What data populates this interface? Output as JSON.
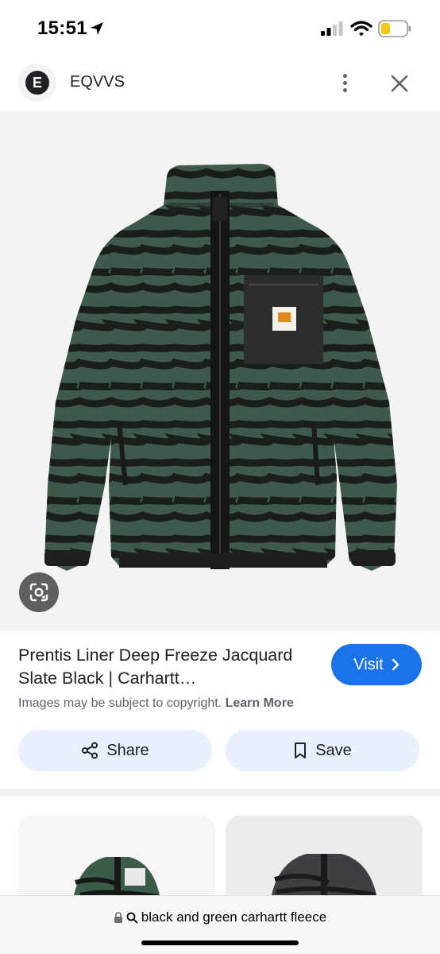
{
  "status_bar": {
    "time": "15:51",
    "icons": [
      "location-arrow-icon",
      "cellular-signal-icon",
      "wifi-icon",
      "battery-low-icon"
    ],
    "battery_color": "#f5c518"
  },
  "source": {
    "avatar_letter": "E",
    "name": "EQVVS",
    "icons": [
      "more-vert-icon",
      "close-icon"
    ]
  },
  "image": {
    "subject": "green and black striped sherpa fleece jacket",
    "lens_icon": "google-lens-icon"
  },
  "result": {
    "title": "Prentis Liner Deep Freeze Jacquard Slate Black | Carhartt…",
    "visit_label": "Visit",
    "copyright_text": "Images may be subject to copyright.",
    "learn_more_label": "Learn More"
  },
  "actions": {
    "share_label": "Share",
    "save_label": "Save"
  },
  "url_bar": {
    "query": "black and green carhartt fleece"
  },
  "colors": {
    "accent": "#1a73e8",
    "action_bg": "#e8f0fe",
    "fleece_green": "#3e5a4b",
    "stripe_black": "#1b1f1c"
  }
}
